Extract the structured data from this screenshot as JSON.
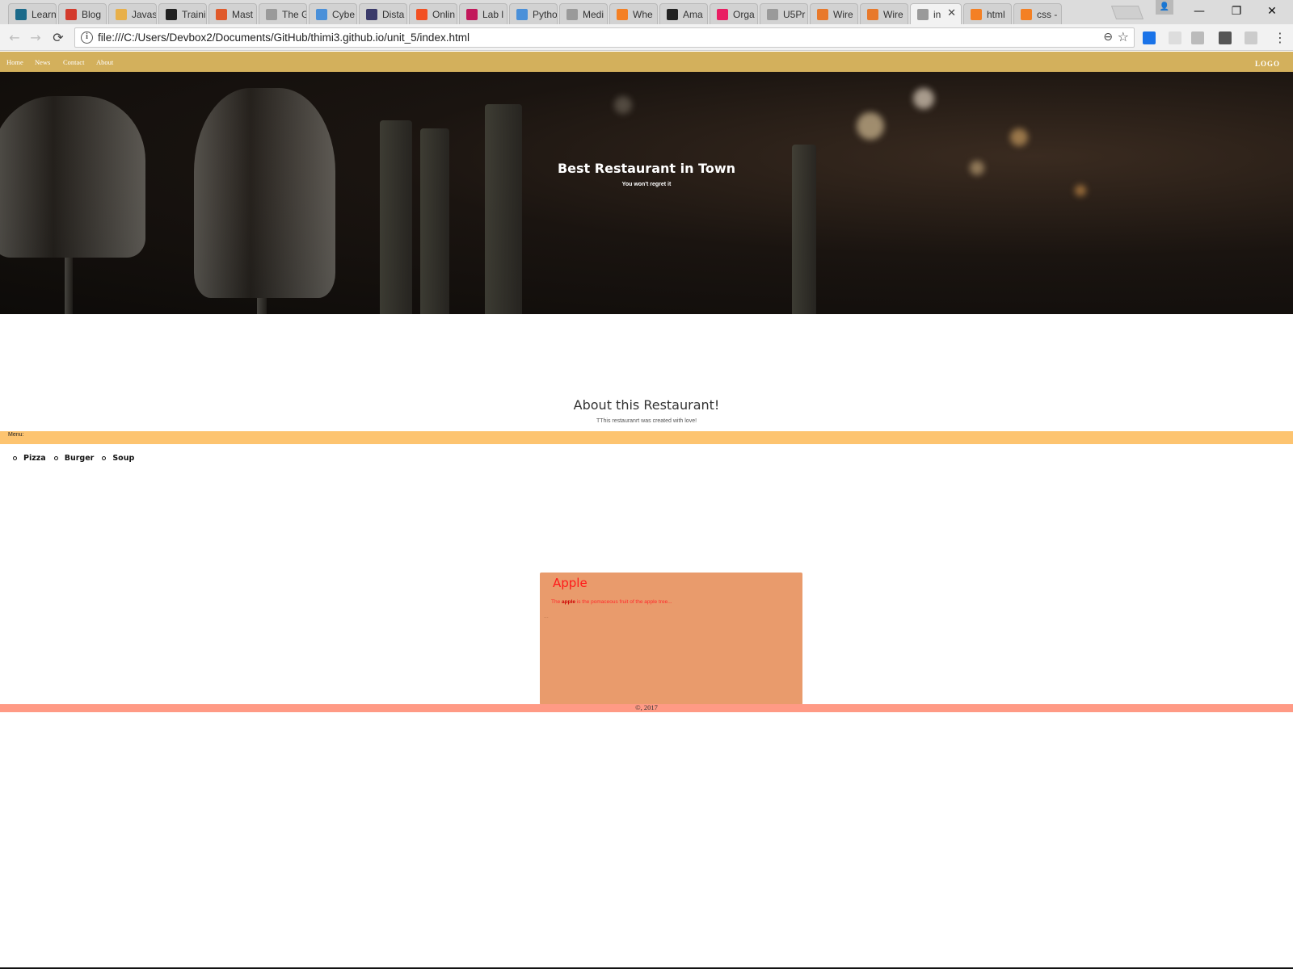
{
  "browser": {
    "tabs": [
      {
        "title": "Learn",
        "favicon_color": "#1b6a8a"
      },
      {
        "title": "Blog",
        "favicon_color": "#d33a2c"
      },
      {
        "title": "Javas",
        "favicon_color": "#e8b04a"
      },
      {
        "title": "Trainin",
        "favicon_color": "#222222"
      },
      {
        "title": "Mast",
        "favicon_color": "#e05a2b"
      },
      {
        "title": "The G",
        "favicon_color": "#9a9a9a"
      },
      {
        "title": "Cybe",
        "favicon_color": "#4a90d9"
      },
      {
        "title": "Dista",
        "favicon_color": "#3a3a6a"
      },
      {
        "title": "Onlin",
        "favicon_color": "#f25022"
      },
      {
        "title": "Lab l",
        "favicon_color": "#c2185b"
      },
      {
        "title": "Pytho",
        "favicon_color": "#4a90d9"
      },
      {
        "title": "Medi",
        "favicon_color": "#9a9a9a"
      },
      {
        "title": "Whe",
        "favicon_color": "#f48024"
      },
      {
        "title": "Ama",
        "favicon_color": "#222222"
      },
      {
        "title": "Orga",
        "favicon_color": "#e91e63"
      },
      {
        "title": "U5Pr",
        "favicon_color": "#9a9a9a"
      },
      {
        "title": "Wire",
        "favicon_color": "#e8792b"
      },
      {
        "title": "Wire",
        "favicon_color": "#e8792b"
      },
      {
        "title": "in",
        "favicon_color": "#9a9a9a",
        "active": true
      },
      {
        "title": "html",
        "favicon_color": "#f48024"
      },
      {
        "title": "css -",
        "favicon_color": "#f48024"
      }
    ],
    "tab_close_glyph": "✕",
    "window_buttons": {
      "minimize": "—",
      "restore": "❐",
      "close": "✕"
    },
    "nav": {
      "back": "←",
      "forward": "→",
      "reload": "⟳"
    },
    "url": "file:///C:/Users/Devbox2/Documents/GitHub/thimi3.github.io/unit_5/index.html",
    "info_glyph": "i",
    "zoom_glyph": "⊖",
    "star_glyph": "☆",
    "menu_glyph": "⋮",
    "extension_colors": [
      "#1a73e8",
      "#dddddd",
      "#bbbbbb",
      "#555555",
      "#cccccc"
    ]
  },
  "site": {
    "nav_links": [
      "Home",
      "News",
      "Contact",
      "About"
    ],
    "logo": "LOGO",
    "nav_color": "#d3b05c",
    "hero": {
      "title": "Best Restaurant in Town",
      "subtitle": "You won't regret it"
    },
    "about": {
      "title": "About this Restaurant!",
      "text": "TThis restauranrt was created with love!"
    },
    "menu": {
      "label": "Menu:",
      "items": [
        "Pizza",
        "Burger",
        "Soup"
      ],
      "bar_color": "#fdc470"
    },
    "card": {
      "title": "Apple",
      "text_before": "The ",
      "highlight": "apple",
      "text_after": " is the pomaceous fruit of the apple tree...",
      "dots": "...",
      "background": "#e99b6c"
    },
    "footer": {
      "text": "©, 2017",
      "color": "#ff9a85"
    }
  }
}
